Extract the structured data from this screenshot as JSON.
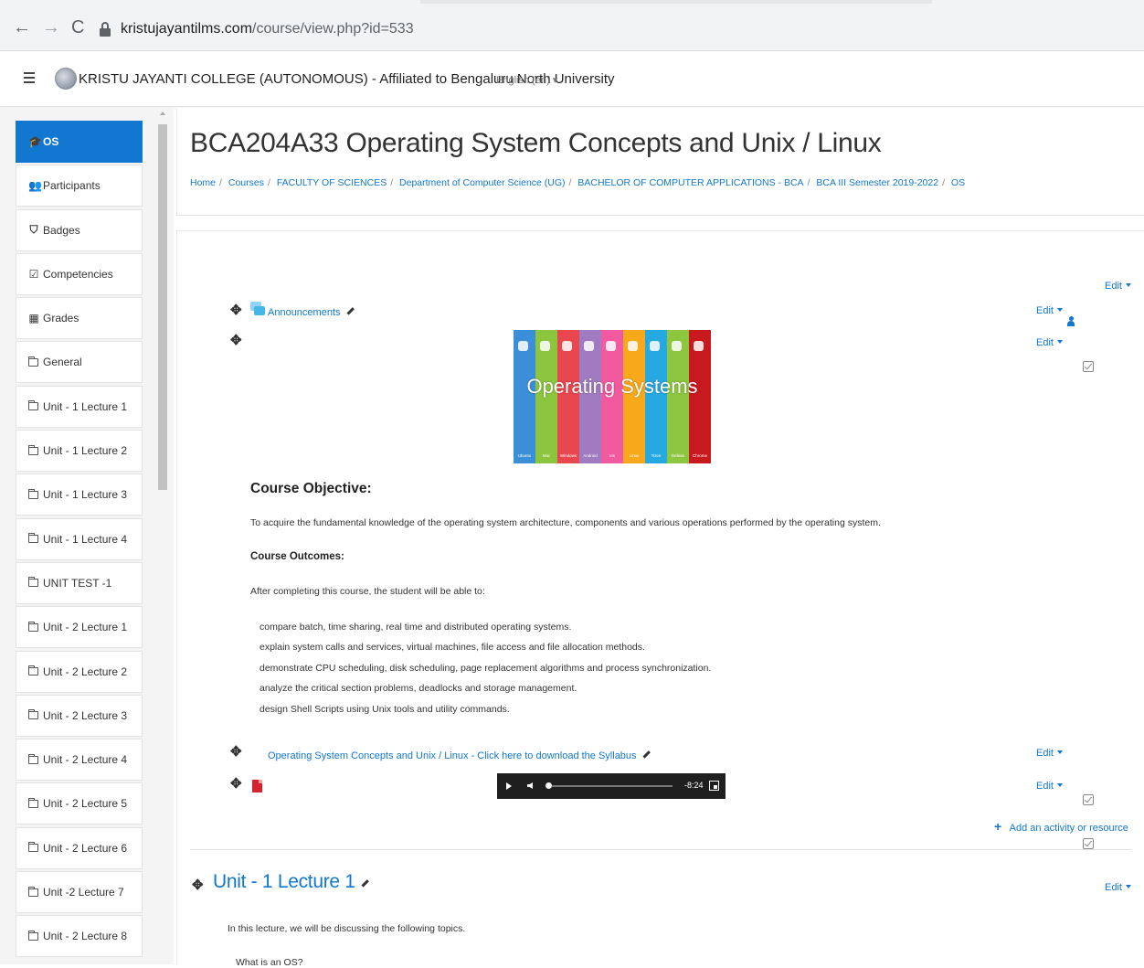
{
  "browser": {
    "url_host": "kristujayantilms.com",
    "url_path": "/course/view.php?id=533"
  },
  "navbar": {
    "site_name": "KRISTU JAYANTI COLLEGE (AUTONOMOUS) - Affiliated to Bengaluru North University",
    "language": "English (en) ▾"
  },
  "sidebar": {
    "items": [
      {
        "label": "OS",
        "icon": "graduation-cap-icon",
        "active": true
      },
      {
        "label": "Participants",
        "icon": "users-icon"
      },
      {
        "label": "Badges",
        "icon": "shield-icon"
      },
      {
        "label": "Competencies",
        "icon": "checkbox-icon"
      },
      {
        "label": "Grades",
        "icon": "table-icon"
      },
      {
        "label": "General",
        "icon": "folder-icon"
      },
      {
        "label": "Unit - 1 Lecture 1",
        "icon": "folder-icon"
      },
      {
        "label": "Unit - 1 Lecture 2",
        "icon": "folder-icon"
      },
      {
        "label": "Unit - 1 Lecture 3",
        "icon": "folder-icon"
      },
      {
        "label": "Unit - 1 Lecture 4",
        "icon": "folder-icon"
      },
      {
        "label": "UNIT TEST -1",
        "icon": "folder-icon"
      },
      {
        "label": "Unit - 2 Lecture 1",
        "icon": "folder-icon"
      },
      {
        "label": "Unit - 2 Lecture 2",
        "icon": "folder-icon"
      },
      {
        "label": "Unit - 2 Lecture 3",
        "icon": "folder-icon"
      },
      {
        "label": "Unit - 2 Lecture 4",
        "icon": "folder-icon"
      },
      {
        "label": "Unit - 2 Lecture 5",
        "icon": "folder-icon"
      },
      {
        "label": "Unit - 2 Lecture 6",
        "icon": "folder-icon"
      },
      {
        "label": "Unit -2 Lecture 7",
        "icon": "folder-icon"
      },
      {
        "label": "Unit - 2 Lecture 8",
        "icon": "folder-icon"
      }
    ]
  },
  "header": {
    "title": "BCA204A33 Operating System Concepts and Unix / Linux",
    "breadcrumb": [
      "Home",
      "Courses",
      "FACULTY OF SCIENCES",
      "Department of Computer Science (UG)",
      "BACHELOR OF COMPUTER APPLICATIONS - BCA",
      "BCA III Semester 2019-2022",
      "OS"
    ]
  },
  "content": {
    "edit_label": "Edit",
    "announcements_label": "Announcements",
    "banner": {
      "title": "Operating Systems",
      "stripes": [
        {
          "label": "Ubuntu",
          "color": "#3b8fd6"
        },
        {
          "label": "Mac",
          "color": "#8cc63f"
        },
        {
          "label": "Windows",
          "color": "#e9474f"
        },
        {
          "label": "Android",
          "color": "#a07bc1"
        },
        {
          "label": "ios",
          "color": "#f25aa0"
        },
        {
          "label": "Linux",
          "color": "#f8a81b"
        },
        {
          "label": "Tizen",
          "color": "#26a9e0"
        },
        {
          "label": "Debian",
          "color": "#8dc63f"
        },
        {
          "label": "Chrome",
          "color": "#c8191f"
        }
      ]
    },
    "course_objective_heading": "Course Objective:",
    "course_objective_text": "To acquire the fundamental knowledge of the operating system architecture, components and various operations performed by the operating system.",
    "course_outcomes_heading": "Course Outcomes:",
    "outcomes_intro": "After completing this course, the student will be able to:",
    "outcomes": [
      "compare batch, time sharing, real time and distributed operating systems.",
      "explain system calls and services, virtual machines, file access and file allocation methods.",
      "demonstrate CPU scheduling, disk scheduling, page replacement algorithms and process synchronization.",
      "analyze the critical section problems, deadlocks and storage management.",
      "design Shell Scripts using Unix tools and utility commands."
    ],
    "syllabus_link": "Operating System Concepts and Unix / Linux - Click here to download the Syllabus",
    "audio_time": "-8:24",
    "add_activity": "Add an activity or resource",
    "section2_title": "Unit - 1 Lecture 1",
    "section2_intro": "In this lecture, we will be discussing the following topics.",
    "section2_first_topic": "What is an OS?"
  },
  "colors": {
    "accent": "#1177d1",
    "sidebar_bg": "#f4f4f4",
    "active_bg": "#1177d1"
  }
}
